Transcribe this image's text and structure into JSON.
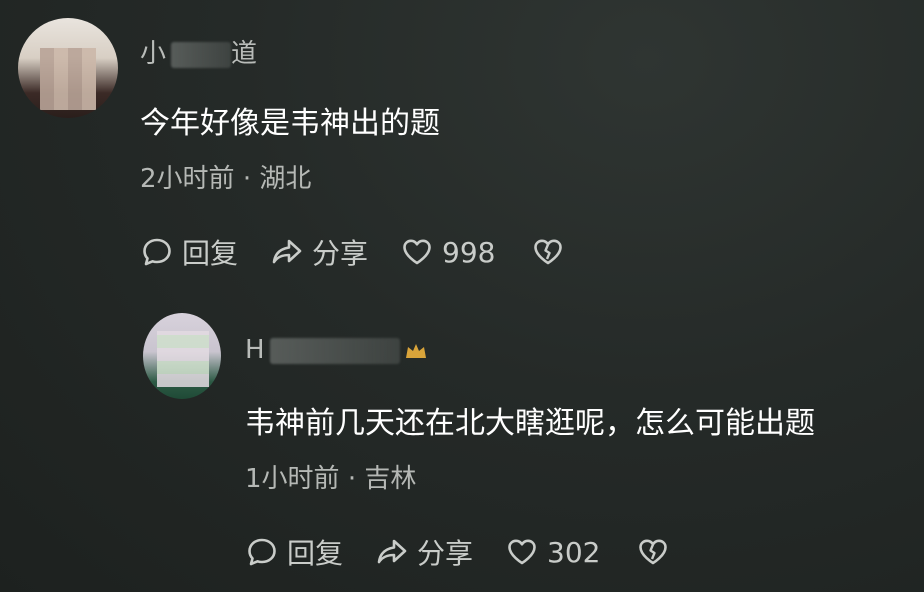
{
  "comments": [
    {
      "username_visible": "小",
      "username_tail": "道",
      "text": "今年好像是韦神出的题",
      "time": "2小时前",
      "location": "湖北",
      "reply_label": "回复",
      "share_label": "分享",
      "likes": "998"
    },
    {
      "username_visible": "H",
      "text": "韦神前几天还在北大瞎逛呢，怎么可能出题",
      "time": "1小时前",
      "location": "吉林",
      "reply_label": "回复",
      "share_label": "分享",
      "likes": "302"
    }
  ],
  "separator": "·",
  "icons": {
    "reply": "speech-bubble-icon",
    "share": "share-arrow-icon",
    "like": "heart-icon",
    "dislike": "broken-heart-icon",
    "badge": "crown-icon"
  },
  "colors": {
    "background": "#252a28",
    "text_primary": "#ffffff",
    "text_secondary": "#b5b8b5",
    "badge": "#d9a43a"
  }
}
